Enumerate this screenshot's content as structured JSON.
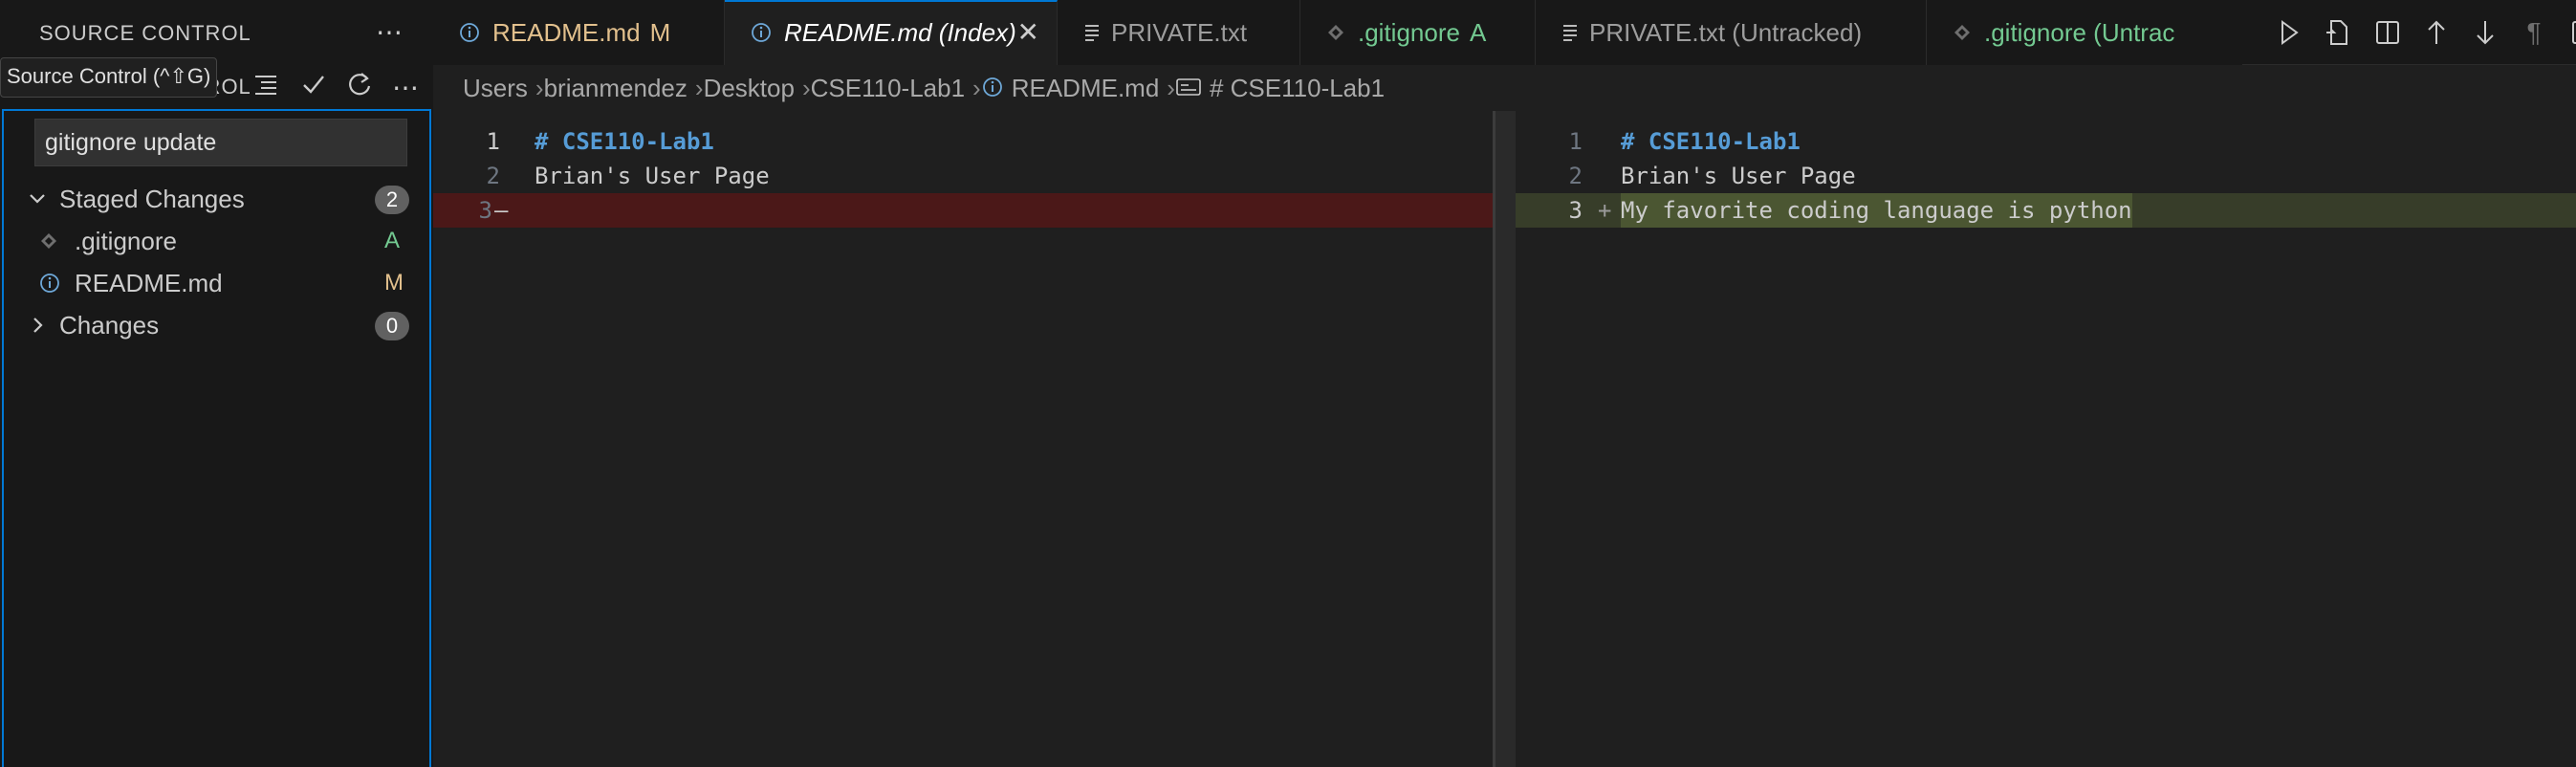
{
  "sidebar": {
    "title": "SOURCE CONTROL",
    "subtitle": "SOURCE CONTROL",
    "tooltip": "Source Control (^⇧G)",
    "commit_message": "gitignore update",
    "staged": {
      "label": "Staged Changes",
      "count": "2",
      "files": [
        {
          "name": ".gitignore",
          "status": "A",
          "status_color": "#73c991",
          "icon": "diamond-icon"
        },
        {
          "name": "README.md",
          "status": "M",
          "status_color": "#e2c08d",
          "icon": "info-icon"
        }
      ]
    },
    "changes": {
      "label": "Changes",
      "count": "0"
    }
  },
  "tabs": [
    {
      "label": "README.md",
      "status": "M",
      "status_color": "#e2c08d",
      "icon": "info-icon",
      "active": false
    },
    {
      "label": "README.md (Index)",
      "status": "",
      "icon": "info-icon",
      "active": true
    },
    {
      "label": "PRIVATE.txt",
      "status": "",
      "icon": "lines-icon",
      "active": false
    },
    {
      "label": ".gitignore",
      "status": "A",
      "status_color": "#73c991",
      "icon": "diamond-icon",
      "active": false
    },
    {
      "label": "PRIVATE.txt (Untracked)",
      "status": "",
      "icon": "lines-icon",
      "active": false
    },
    {
      "label": ".gitignore (Untrac",
      "status": "",
      "icon": "diamond-icon",
      "active": false
    }
  ],
  "breadcrumb": [
    "Users",
    "brianmendez",
    "Desktop",
    "CSE110-Lab1",
    "README.md",
    "# CSE110-Lab1"
  ],
  "editor_left": {
    "lines": [
      {
        "num": "1",
        "text": "# CSE110-Lab1",
        "kind": "heading"
      },
      {
        "num": "2",
        "text": "Brian's User Page",
        "kind": "normal"
      },
      {
        "num": "3",
        "text": "",
        "kind": "removed",
        "marker": "—"
      }
    ]
  },
  "editor_right": {
    "lines": [
      {
        "num": "1",
        "text": "# CSE110-Lab1",
        "kind": "heading"
      },
      {
        "num": "2",
        "text": "Brian's User Page",
        "kind": "normal"
      },
      {
        "num": "3",
        "text": "My favorite coding language is python",
        "kind": "inserted",
        "marker": "+"
      }
    ]
  },
  "colors": {
    "accent": "#0078d4",
    "removed_bg": "#4b1818",
    "inserted_bg": "#373d29",
    "heading": "#569cd6"
  }
}
